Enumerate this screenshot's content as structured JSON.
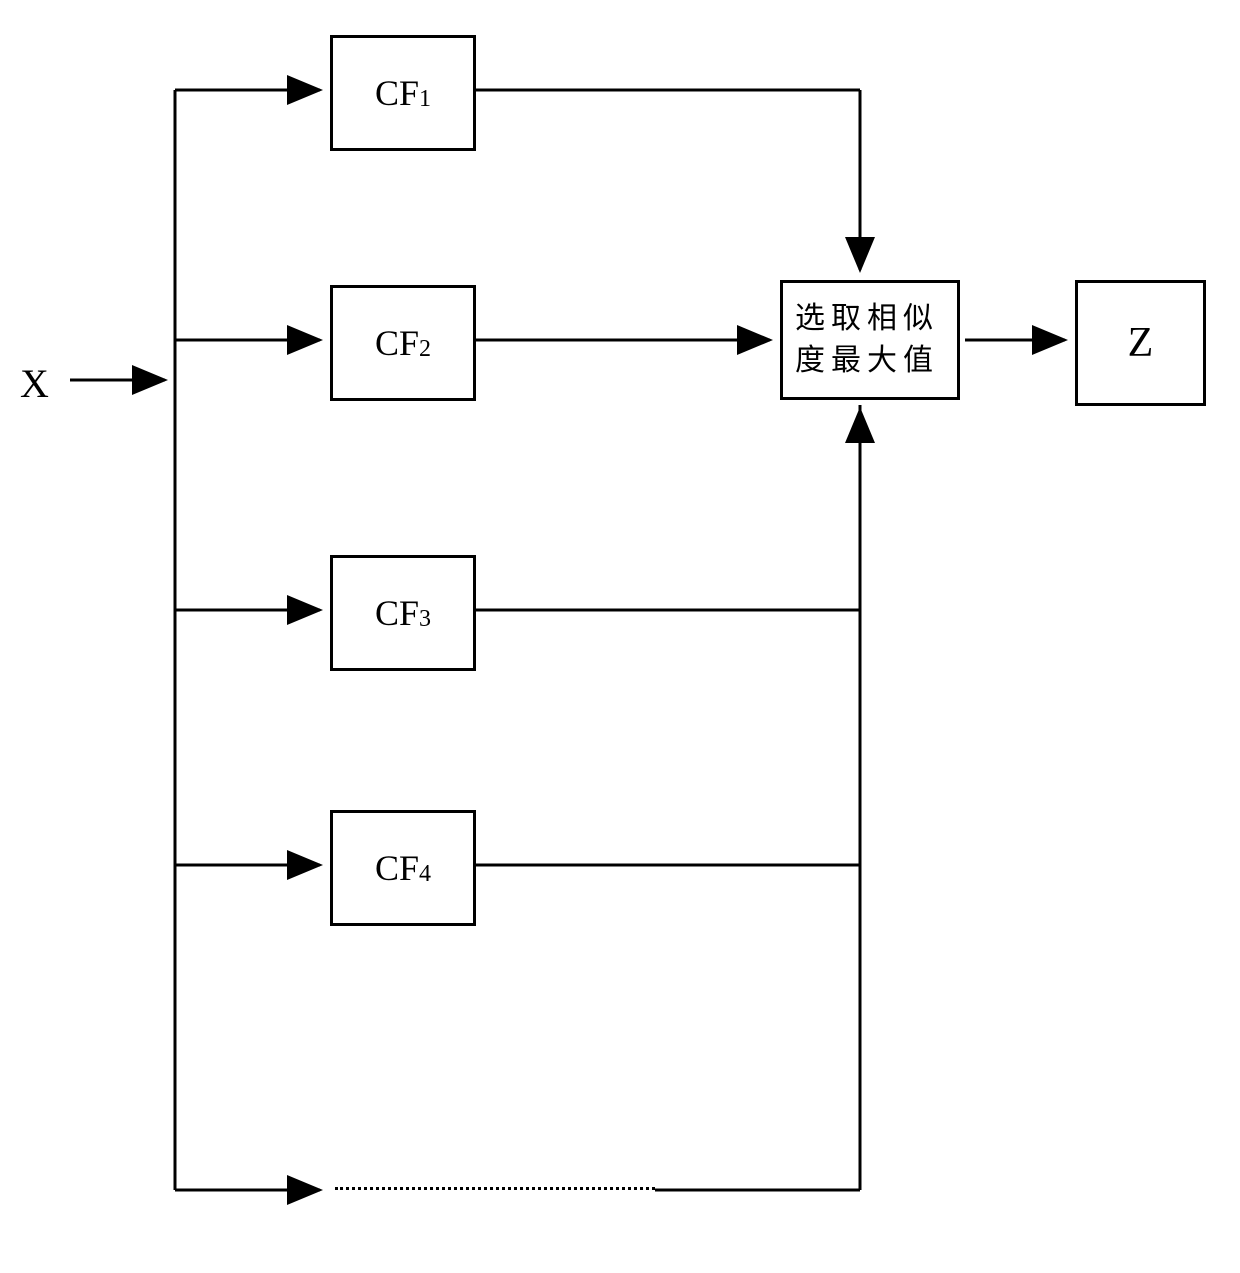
{
  "input": {
    "label": "X"
  },
  "filters": [
    {
      "prefix": "CF",
      "subscript": "1"
    },
    {
      "prefix": "CF",
      "subscript": "2"
    },
    {
      "prefix": "CF",
      "subscript": "3"
    },
    {
      "prefix": "CF",
      "subscript": "4"
    }
  ],
  "selector": {
    "line1": "选取相似",
    "line2": "度最大值"
  },
  "output": {
    "label": "Z"
  }
}
